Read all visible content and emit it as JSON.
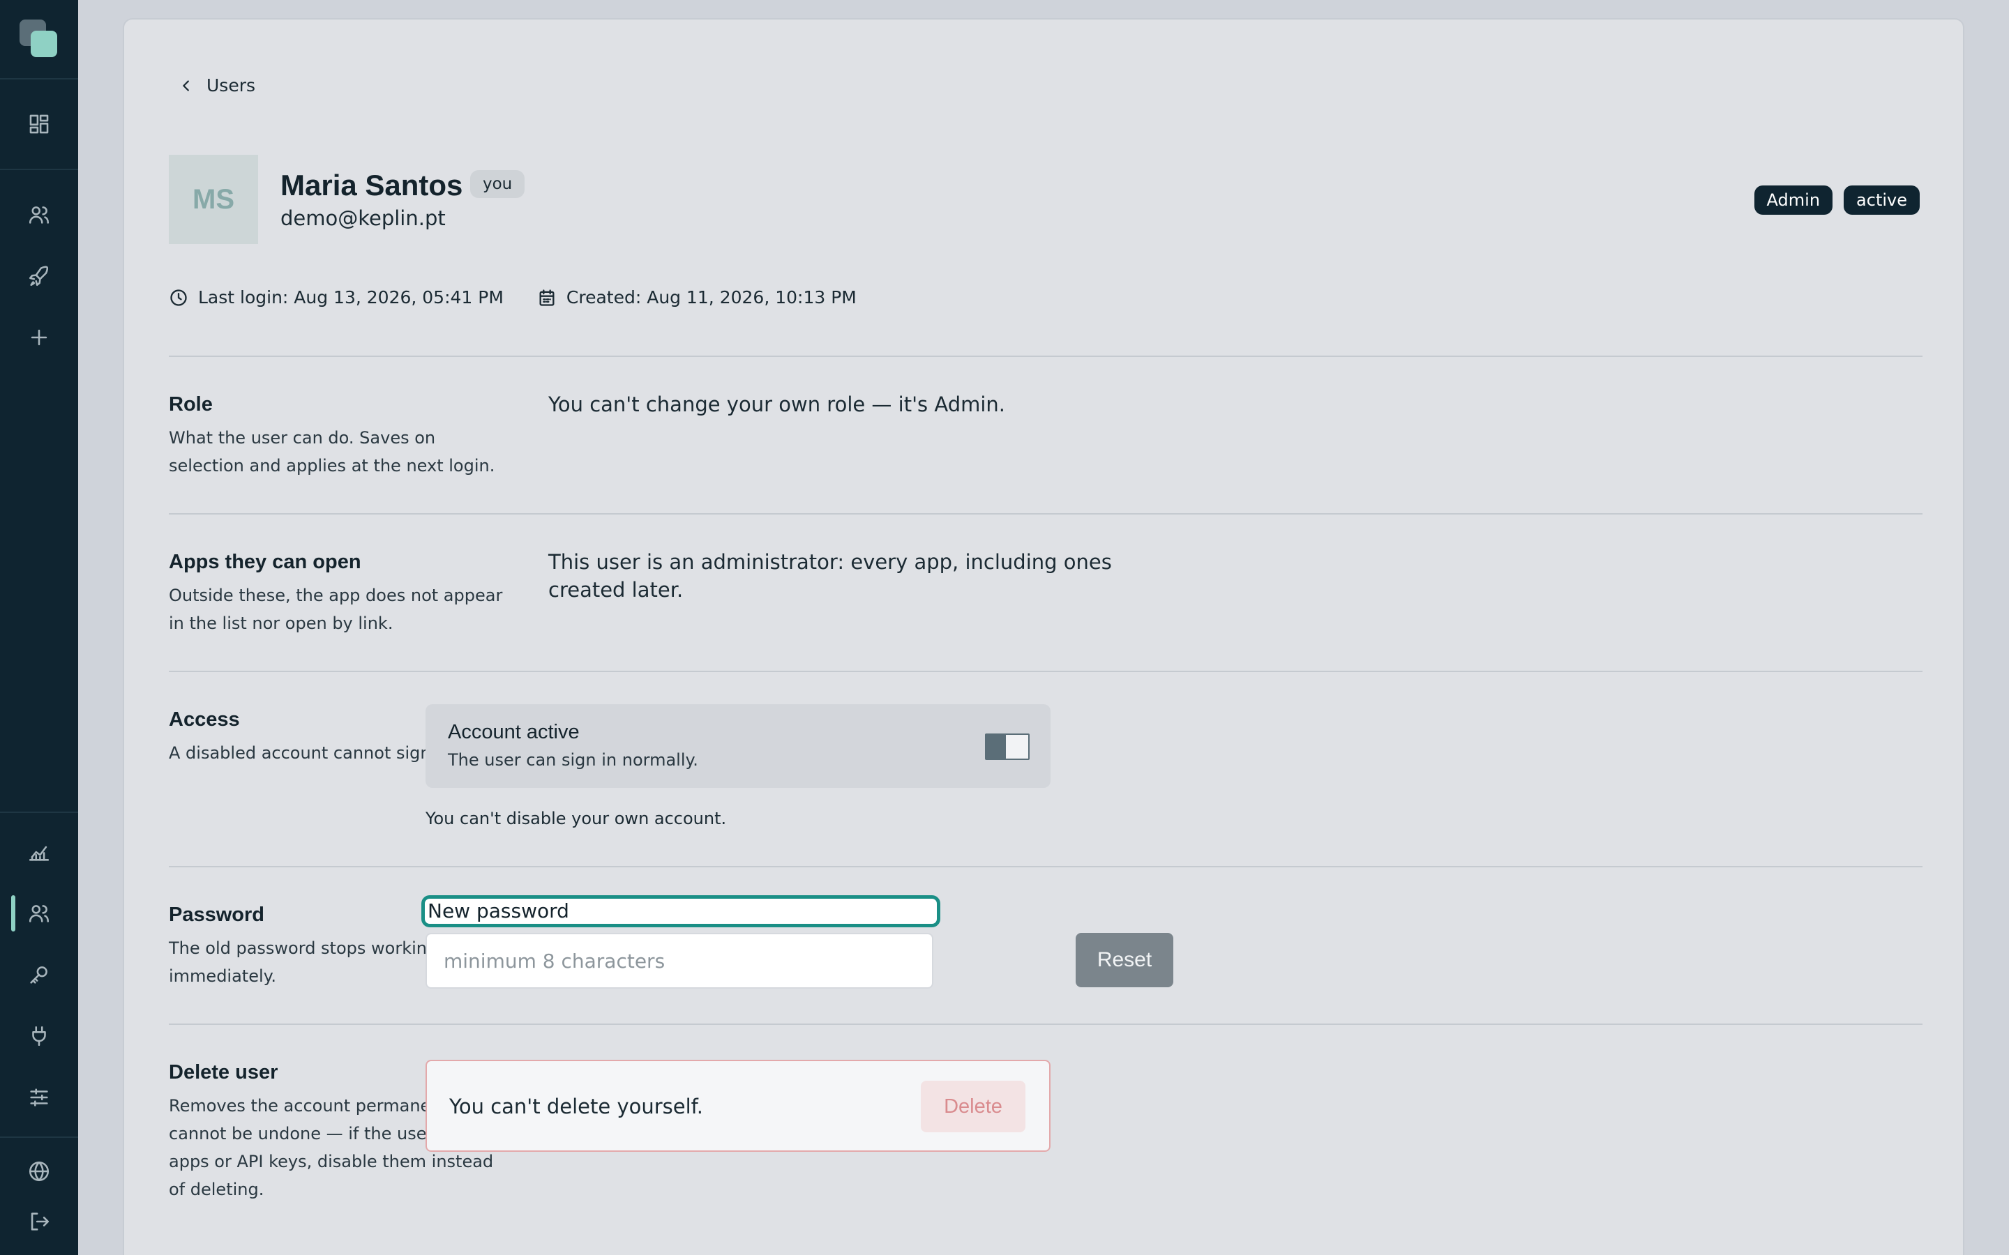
{
  "sidebar": {
    "icons": [
      "logo",
      "dashboard-icon",
      "users-icon",
      "rocket-icon",
      "plus-icon",
      "analytics-icon",
      "users-icon",
      "key-icon",
      "plug-icon",
      "sliders-icon",
      "globe-icon",
      "logout-icon"
    ],
    "accent_color": "#8fd1c4"
  },
  "nav": {
    "back_label": "Users"
  },
  "user": {
    "initials": "MS",
    "name": "Maria Santos",
    "self_badge": "you",
    "email": "demo@keplin.pt",
    "role_badge": "Admin",
    "status_badge": "active",
    "last_login": "Last login: Aug 13, 2026, 05:41 PM",
    "created": "Created: Aug 11, 2026, 10:13 PM"
  },
  "sections": {
    "role": {
      "title": "Role",
      "description": "What the user can do. Saves on selection and applies at the next login.",
      "value": "You can't change your own role — it's Admin."
    },
    "apps": {
      "title": "Apps they can open",
      "description": "Outside these, the app does not appear in the list nor open by link.",
      "value": "This user is an administrator: every app, including ones created later."
    },
    "access": {
      "title": "Access",
      "description": "A disabled account cannot sign in.",
      "box_title": "Account active",
      "box_subtitle": "The user can sign in normally.",
      "note": "You can't disable your own account."
    },
    "password": {
      "title": "Password",
      "description": "The old password stops working immediately.",
      "field_label": "New password",
      "placeholder": "minimum 8 characters",
      "button": "Reset"
    },
    "delete": {
      "title": "Delete user",
      "description": "Removes the account permanently. It cannot be undone — if the user owns apps or API keys, disable them instead of deleting.",
      "box_text": "You can't delete yourself.",
      "button": "Delete"
    }
  }
}
